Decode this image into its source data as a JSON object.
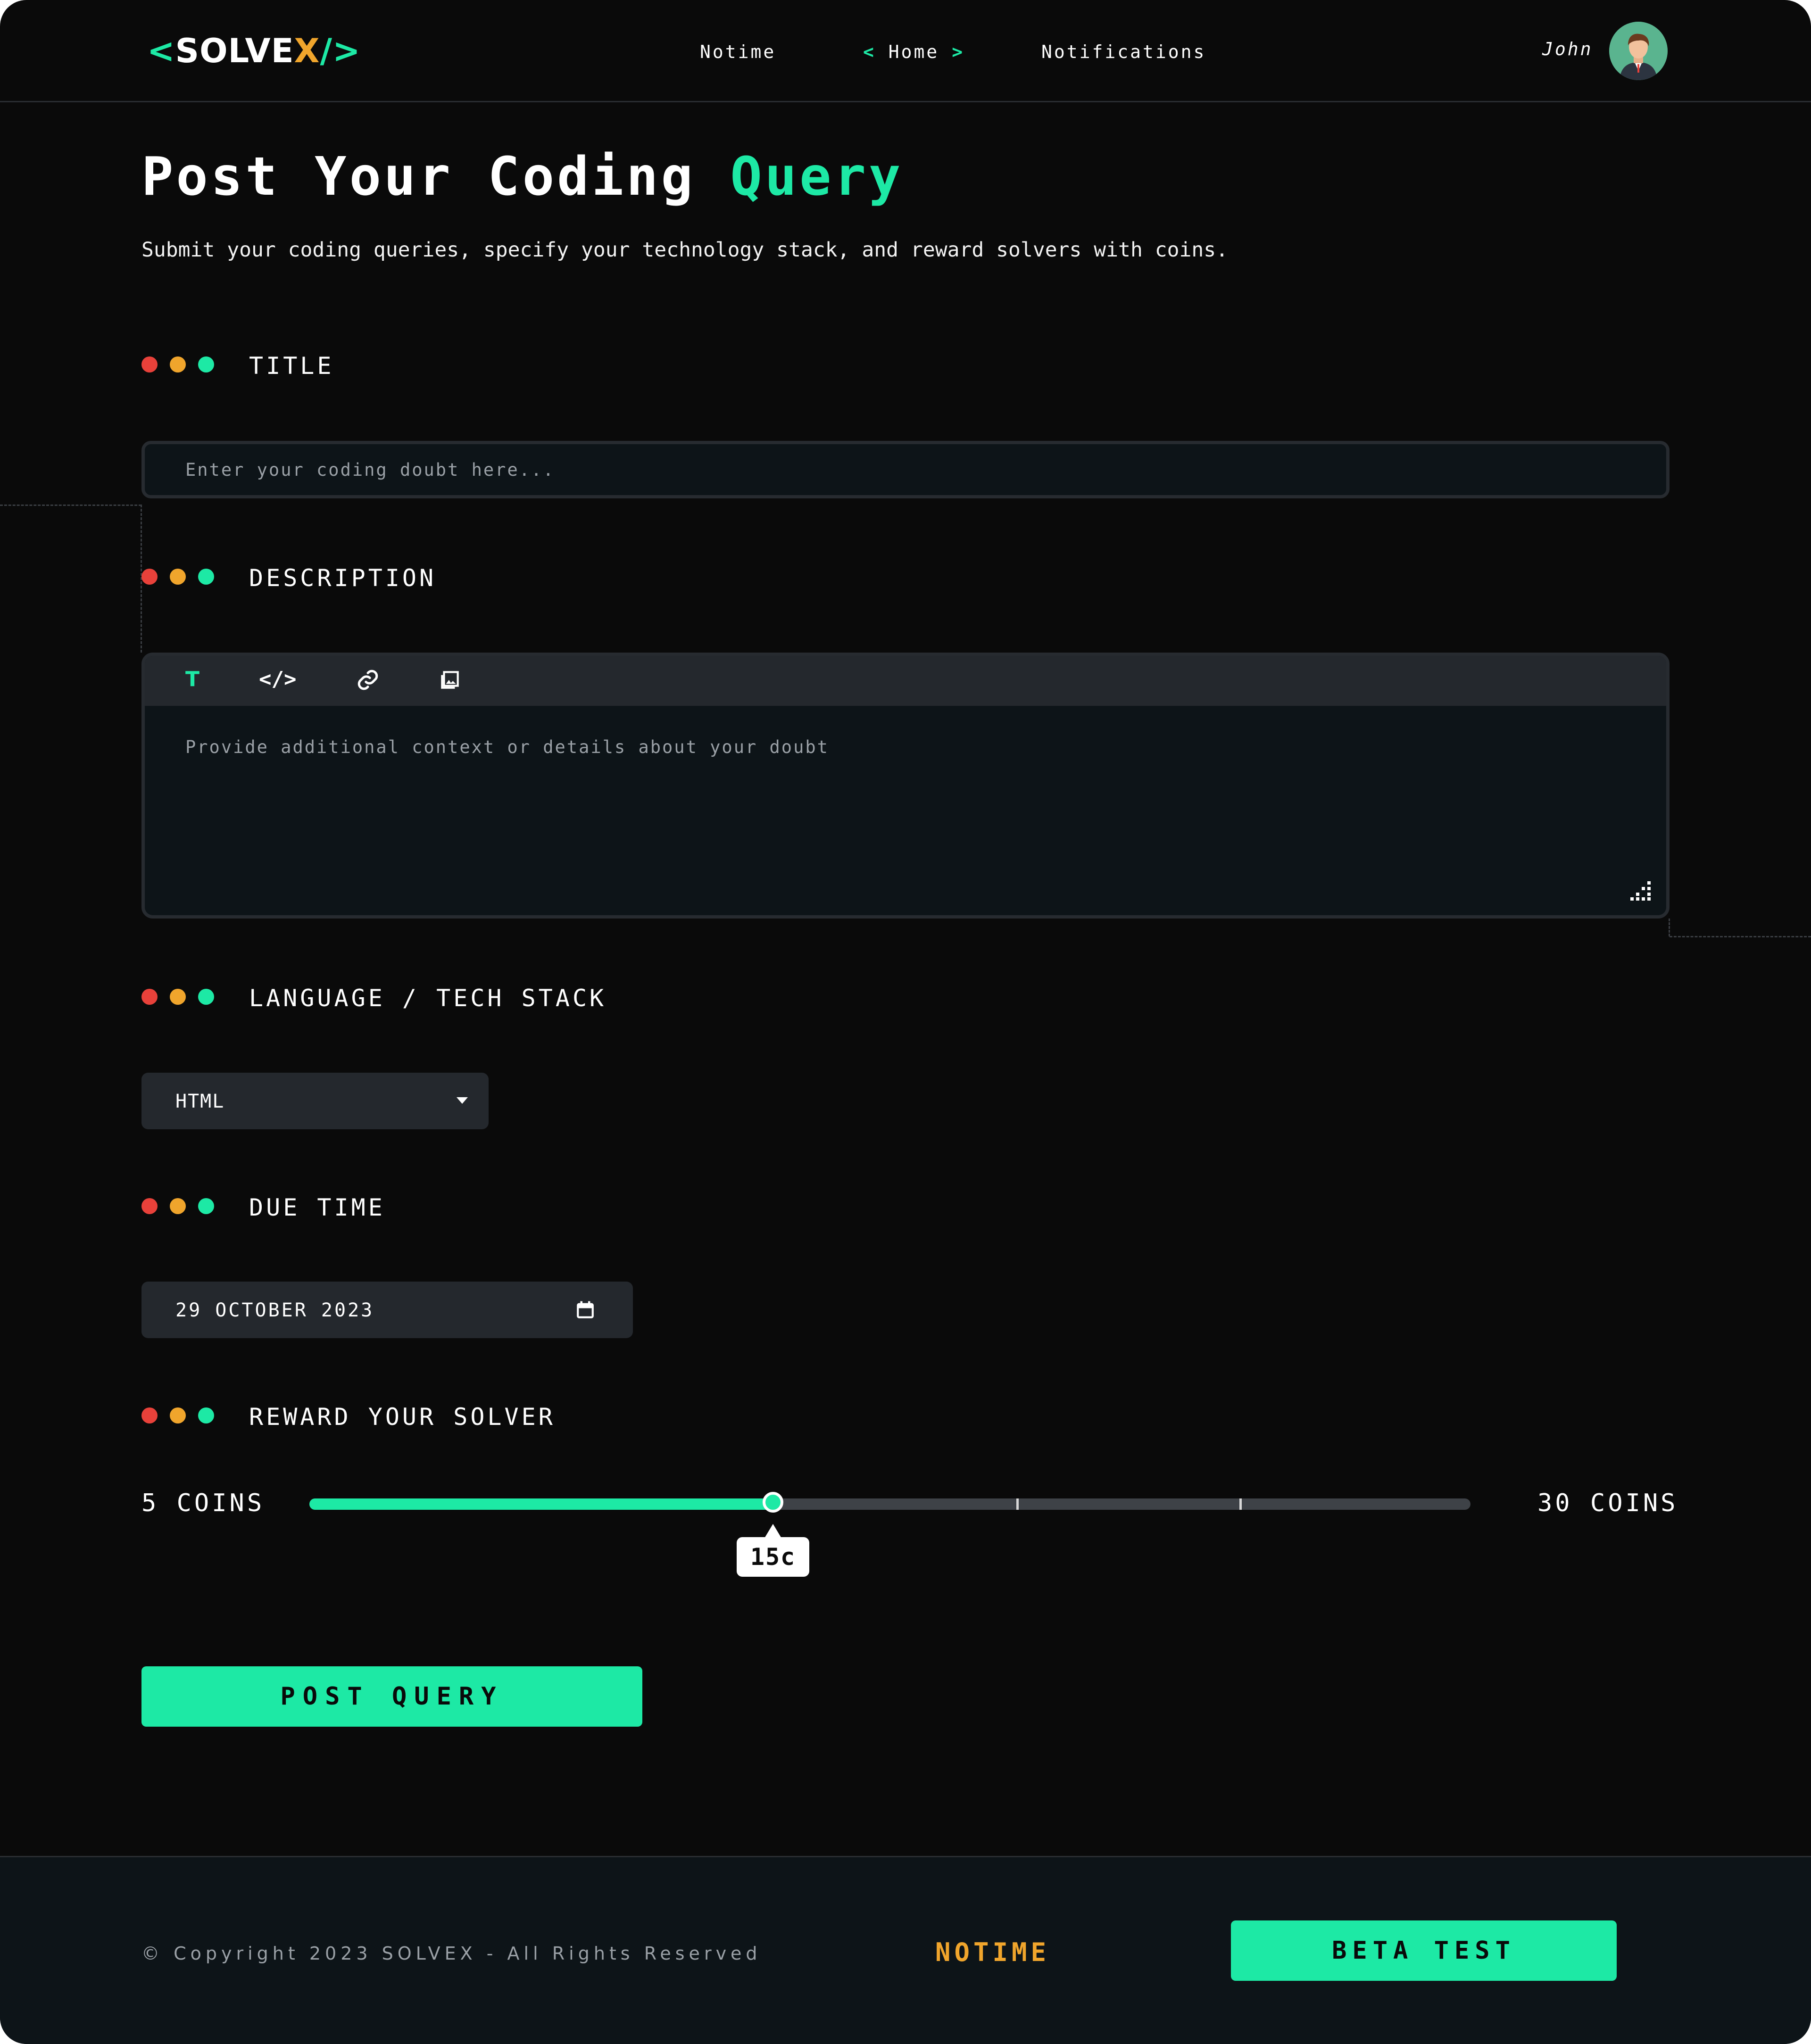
{
  "nav": {
    "logo_open": "<",
    "logo_text": "SOLVE",
    "logo_x": "X",
    "logo_close": "/>",
    "links": [
      {
        "label": "Notime"
      },
      {
        "label": "Home",
        "chev_left": "<",
        "chev_right": ">"
      },
      {
        "label": "Notifications"
      }
    ],
    "user_name": "John"
  },
  "header": {
    "title_main": "Post Your Coding",
    "title_accent": "Query",
    "subtitle": "Submit your coding queries, specify your technology stack, and reward solvers with coins."
  },
  "sections": {
    "title": {
      "label": "TITLE",
      "placeholder": "Enter your coding doubt here..."
    },
    "description": {
      "label": "DESCRIPTION",
      "placeholder": "Provide additional context or details about your doubt",
      "toolbar": [
        {
          "icon": "text-format-icon",
          "glyph": "T"
        },
        {
          "icon": "code-icon",
          "glyph": "</>"
        },
        {
          "icon": "link-icon"
        },
        {
          "icon": "image-icon"
        }
      ]
    },
    "language": {
      "label": "LANGUAGE / TECH STACK",
      "selected": "HTML"
    },
    "due_time": {
      "label": "DUE TIME",
      "value": "29 OCTOBER 2023"
    },
    "reward": {
      "label": "REWARD YOUR SOLVER",
      "min_label": "5 COINS",
      "max_label": "30 COINS",
      "min": 5,
      "max": 30,
      "value": 15,
      "value_label": "15c"
    }
  },
  "actions": {
    "post_label": "POST QUERY"
  },
  "footer": {
    "copyright": "© Copyright 2023 SOLVEX - All Rights Reserved",
    "brand": "NOTIME",
    "beta_label": "BETA TEST"
  },
  "colors": {
    "background": "#0a0a0a",
    "accent": "#1de9a5",
    "brand_orange": "#f0a52c",
    "dot_red": "#e8413a",
    "panel": "#24282d"
  }
}
